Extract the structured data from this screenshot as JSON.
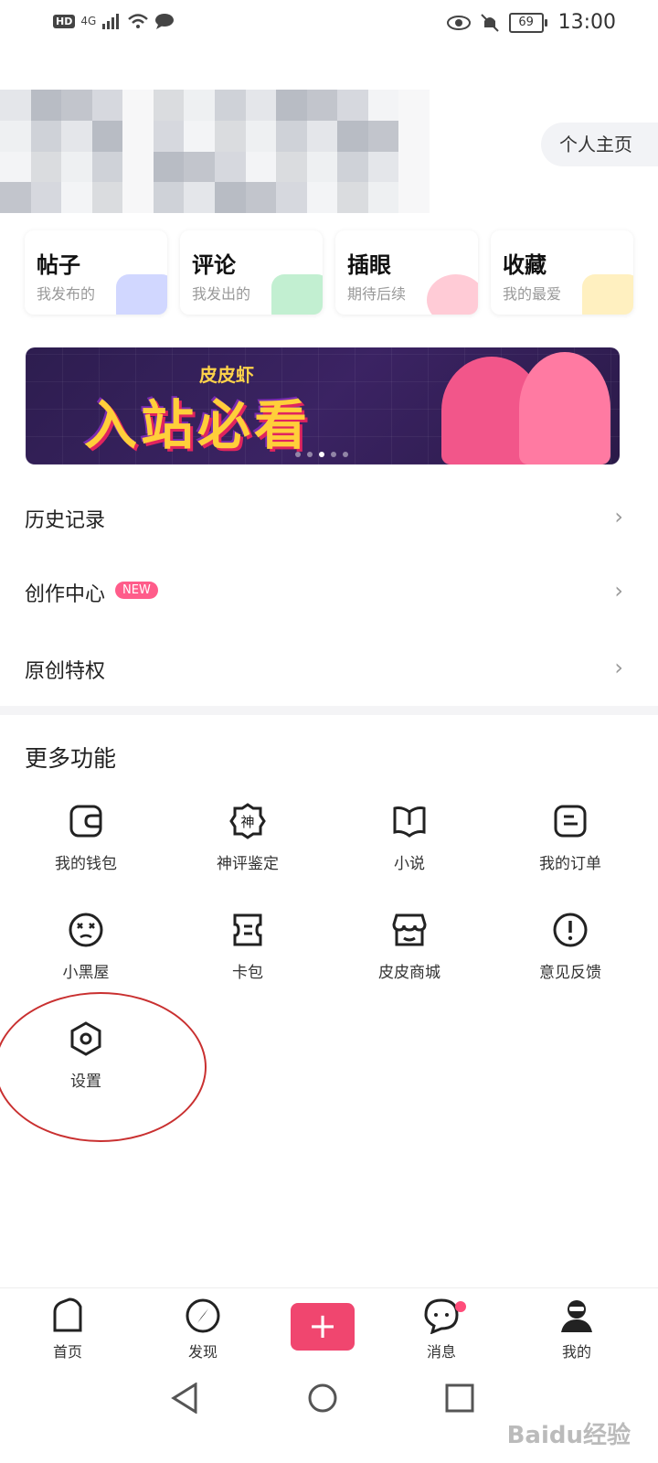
{
  "status_bar": {
    "hd": "HD",
    "network": "4G",
    "battery": "69",
    "time": "13:00"
  },
  "profile": {
    "home_button": "个人主页"
  },
  "cards": [
    {
      "title": "帖子",
      "subtitle": "我发布的",
      "color": "#7b8cff"
    },
    {
      "title": "评论",
      "subtitle": "我发出的",
      "color": "#4fd07a"
    },
    {
      "title": "插眼",
      "subtitle": "期待后续",
      "color": "#ff6b8a"
    },
    {
      "title": "收藏",
      "subtitle": "我的最爱",
      "color": "#ffd34a"
    }
  ],
  "banner": {
    "small_text": "皮皮虾",
    "big_text": "入站必看"
  },
  "menu": [
    {
      "label": "历史记录"
    },
    {
      "label": "创作中心",
      "badge": "NEW"
    },
    {
      "label": "原创特权"
    }
  ],
  "more": {
    "title": "更多功能",
    "items": [
      {
        "label": "我的钱包",
        "icon": "wallet-icon"
      },
      {
        "label": "神评鉴定",
        "icon": "god-comment-icon",
        "glyph": "神"
      },
      {
        "label": "小说",
        "icon": "book-icon"
      },
      {
        "label": "我的订单",
        "icon": "order-icon"
      },
      {
        "label": "小黑屋",
        "icon": "dizzy-face-icon"
      },
      {
        "label": "卡包",
        "icon": "card-pack-icon"
      },
      {
        "label": "皮皮商城",
        "icon": "shop-icon"
      },
      {
        "label": "意见反馈",
        "icon": "feedback-icon"
      },
      {
        "label": "设置",
        "icon": "settings-icon"
      }
    ]
  },
  "bottom_nav": {
    "home": "首页",
    "discover": "发现",
    "post": "+",
    "messages": "消息",
    "mine": "我的"
  },
  "watermark": "Baidu经验",
  "colors": {
    "accent": "#f0466f",
    "text": "#222222",
    "muted": "#999999"
  }
}
